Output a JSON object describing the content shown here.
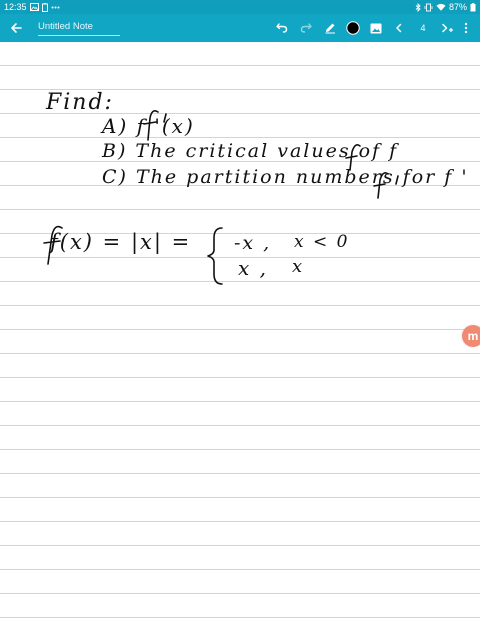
{
  "status_bar": {
    "time": "12:35",
    "battery": "87%",
    "icons": [
      "photo-icon",
      "battery-saver-icon",
      "more-dots-icon",
      "bluetooth-icon",
      "vibrate-icon",
      "wifi-icon",
      "battery-icon"
    ]
  },
  "app_bar": {
    "title": "Untitled Note",
    "page_number": "4",
    "icons": [
      "back-arrow-icon",
      "undo-icon",
      "redo-icon",
      "pen-icon",
      "color-swatch-icon",
      "image-icon",
      "chevron-left-icon",
      "add-page-icon",
      "more-vertical-icon"
    ],
    "colors": {
      "bar": "#11a6c4",
      "status": "#0f9fbd",
      "active_color": "#000000"
    }
  },
  "note": {
    "line_color": "#c5d7ef",
    "handwriting": {
      "find": "Find:",
      "item_a": "A)  f '(x)",
      "item_b": "B)  The  critical  values  of  f",
      "item_c": "C)  The  partition  numbers  for  f '",
      "eq_lhs": "f(x)  =  |x|  =",
      "case1_expr": "-x ,",
      "case1_cond": "x < 0",
      "case2_expr": "x ,",
      "case2_cond": "x"
    }
  },
  "fab": {
    "label": "m",
    "icon": "app-logo-icon",
    "color": "#f08a73"
  }
}
